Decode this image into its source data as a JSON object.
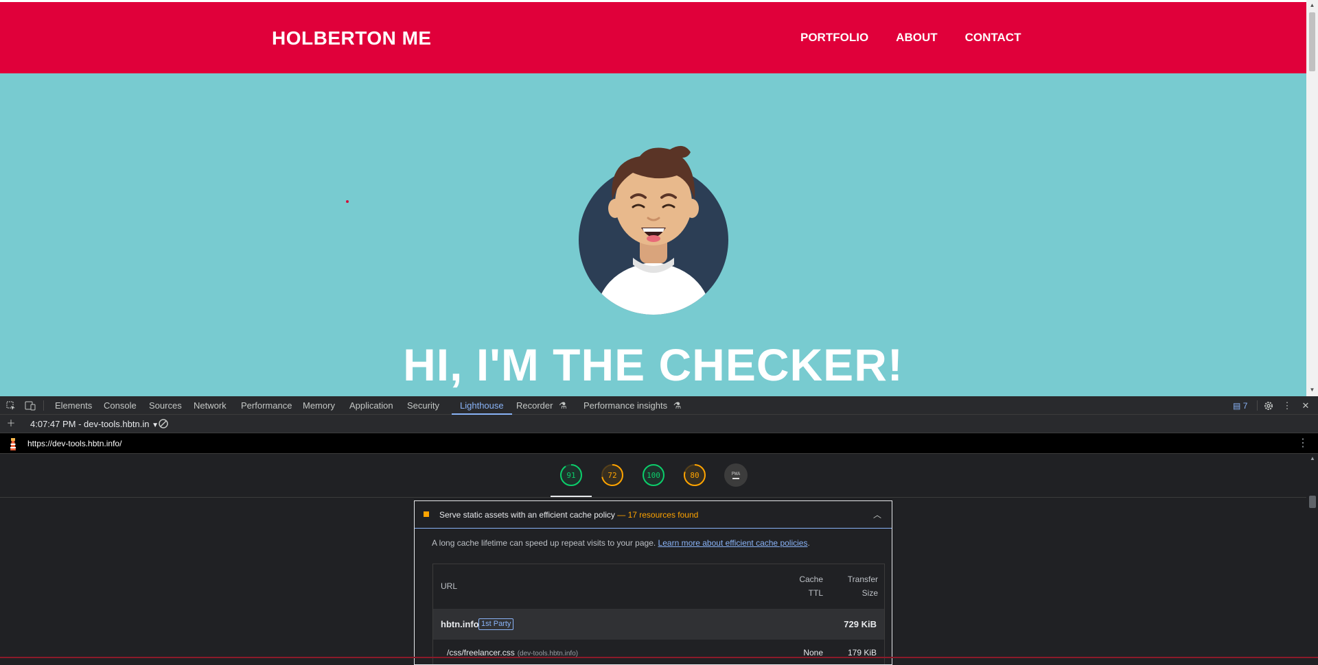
{
  "site": {
    "brand": "HOLBERTON ME",
    "nav": [
      "PORTFOLIO",
      "ABOUT",
      "CONTACT"
    ],
    "hero_title": "HI, I'M THE CHECKER!",
    "colors": {
      "nav": "#e0003a",
      "hero_bg": "#78cbd0"
    }
  },
  "devtools": {
    "tabs": [
      "Elements",
      "Console",
      "Sources",
      "Network",
      "Performance",
      "Memory",
      "Application",
      "Security",
      "Lighthouse",
      "Recorder",
      "Performance insights"
    ],
    "active_tab": "Lighthouse",
    "issues_count": "7",
    "report_selector": "4:07:47 PM - dev-tools.hbtn.in",
    "url": "https://dev-tools.hbtn.info/",
    "scores": [
      {
        "value": "91",
        "color": "#0cce6b",
        "fraction": 0.91
      },
      {
        "value": "72",
        "color": "#ffa400",
        "fraction": 0.72
      },
      {
        "value": "100",
        "color": "#0cce6b",
        "fraction": 1.0
      },
      {
        "value": "80",
        "color": "#ffa400",
        "fraction": 0.8
      }
    ],
    "pwa_label": "PWA",
    "audit": {
      "title": "Serve static assets with an efficient cache policy",
      "display_value": "— 17 resources found",
      "description": "A long cache lifetime can speed up repeat visits to your page.",
      "learn_more": "Learn more about efficient cache policies",
      "learn_more_suffix": ".",
      "columns": {
        "url": "URL",
        "cache_ttl_1": "Cache",
        "cache_ttl_2": "TTL",
        "size_1": "Transfer",
        "size_2": "Size"
      },
      "group": {
        "entity": "hbtn.info",
        "badge": "1st Party",
        "size": "729 KiB"
      },
      "rows": [
        {
          "url": "/css/freelancer.css",
          "host": "(dev-tools.hbtn.info)",
          "ttl": "None",
          "size": "179 KiB"
        }
      ]
    }
  }
}
